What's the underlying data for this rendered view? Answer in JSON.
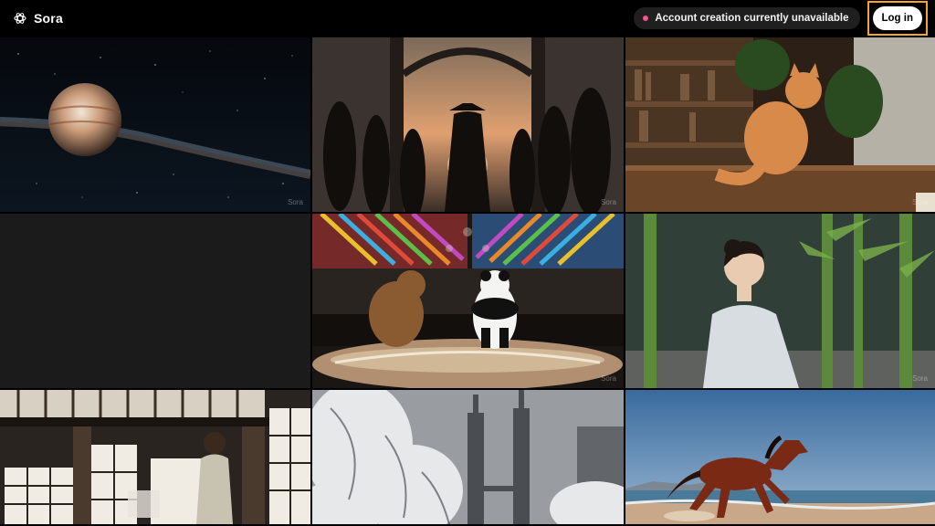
{
  "header": {
    "brand_name": "Sora",
    "logo_icon": "openai-knot-icon",
    "notice_text": "Account creation currently unavailable",
    "notice_dot_color": "#ff4d8d",
    "login_label": "Log in",
    "login_highlight_color": "#f5a623"
  },
  "tiles": [
    {
      "id": "space-planet",
      "watermark": "Sora"
    },
    {
      "id": "silhouette-crowd",
      "watermark": "Sora"
    },
    {
      "id": "orange-cat",
      "watermark": "Sora"
    },
    {
      "id": "empty-tile",
      "watermark": ""
    },
    {
      "id": "panda-bear-sumo",
      "watermark": "Sora"
    },
    {
      "id": "woman-bamboo",
      "watermark": "Sora"
    },
    {
      "id": "japanese-room",
      "watermark": ""
    },
    {
      "id": "snow-towers",
      "watermark": ""
    },
    {
      "id": "horse-beach",
      "watermark": ""
    }
  ]
}
